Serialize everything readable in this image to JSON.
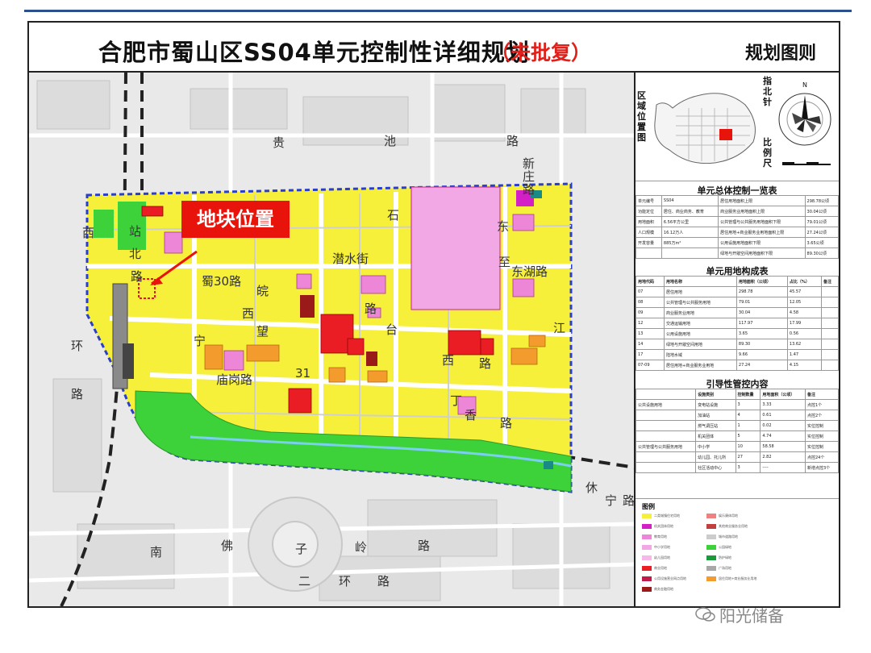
{
  "header": {
    "title": "合肥市蜀山区SS04单元控制性详细规划",
    "status": "（未批复）",
    "sheet": "规划图则"
  },
  "map": {
    "callout": "地块位置",
    "roads": {
      "r1": "贵",
      "r2": "池",
      "r3": "路",
      "r4": "新",
      "r5": "庄",
      "r6": "路",
      "r7": "石",
      "r8": "潜水街",
      "r9": "东",
      "r10": "至",
      "r11": "东湖路",
      "r12": "蜀30路",
      "r13": "皖",
      "r14": "西",
      "r15": "路",
      "r16": "望",
      "r17": "台",
      "r18": "江",
      "r19": "宁",
      "r20": "庙岗路",
      "r21": "31",
      "r22": "西",
      "r23": "路",
      "r24": "丁",
      "r25": "香",
      "r26": "路",
      "r27": "环",
      "r28": "西",
      "r29": "路",
      "r30": "北",
      "r31": "站",
      "r32": "路",
      "r33": "南",
      "r34": "佛",
      "r35": "子",
      "r36": "岭",
      "r37": "路",
      "r38": "休",
      "r39": "宁",
      "r40": "路",
      "r41": "二",
      "r42": "环",
      "r43": "路"
    }
  },
  "side": {
    "locator": {
      "label": "区域位置图",
      "north_label": "指北针",
      "scale_label": "比例尺"
    },
    "overview": {
      "title": "单元总体控制一览表",
      "rows": [
        [
          "单元编号",
          "SS04",
          "居住用地面积上限",
          "298.78公顷"
        ],
        [
          "功能定位",
          "居住、商业商务、教育",
          "商业服务业用地面积上限",
          "30.04公顷"
        ],
        [
          "用地面积",
          "6.56平方公里",
          "公共管理与公共服务用地面积下限",
          "79.01公顷"
        ],
        [
          "人口规模",
          "16.12万人",
          "居住用地+商业服务业用地面积上限",
          "27.24公顷"
        ],
        [
          "开发容量",
          "885万m²",
          "公用设施用地面积下限",
          "3.65公顷"
        ],
        [
          "",
          "",
          "绿地与开敞空间用地面积下限",
          "89.30公顷"
        ]
      ]
    },
    "landuse": {
      "title": "单元用地构成表",
      "header": [
        "用地代码",
        "用地名称",
        "用地面积（公顷）",
        "占比（%）",
        "备注"
      ],
      "rows": [
        [
          "07",
          "居住用地",
          "298.78",
          "45.57",
          ""
        ],
        [
          "08",
          "公共管理与公共服务用地",
          "79.01",
          "12.05",
          ""
        ],
        [
          "09",
          "商业服务业用地",
          "30.04",
          "4.58",
          ""
        ],
        [
          "12",
          "交通运输用地",
          "117.97",
          "17.99",
          ""
        ],
        [
          "13",
          "公用设施用地",
          "3.65",
          "0.56",
          ""
        ],
        [
          "14",
          "绿地与开敞空间用地",
          "89.30",
          "13.62",
          ""
        ],
        [
          "17",
          "陆地水域",
          "9.66",
          "1.47",
          ""
        ],
        [
          "07-09",
          "居住用地+商业服务业用地",
          "27.24",
          "4.15",
          ""
        ]
      ]
    },
    "guidance": {
      "title": "引导性管控内容",
      "header": [
        "",
        "设施类别",
        "控制数量",
        "用地面积（公顷）",
        "备注"
      ],
      "rows": [
        [
          "公共设施用地",
          "变电站设施",
          "3",
          "3.33",
          "点控1个"
        ],
        [
          "",
          "加油站",
          "4",
          "0.61",
          "点控2个"
        ],
        [
          "",
          "燃气调压站",
          "1",
          "0.02",
          "实位控制"
        ],
        [
          "",
          "机关团体",
          "5",
          "4.74",
          "实位控制"
        ],
        [
          "公共管理与公共服务用地",
          "中小学",
          "10",
          "58.58",
          "实位控制"
        ],
        [
          "",
          "幼儿园、托儿所",
          "27",
          "2.82",
          "点控24个"
        ],
        [
          "",
          "社区活动中心",
          "3",
          "----",
          "新增点控3个"
        ]
      ]
    },
    "legend": {
      "title": "图例",
      "items": [
        "二类城镇住宅用地",
        "机关团体用地",
        "教育用地",
        "中小学用地",
        "幼儿园用地",
        "商业用地",
        "公用设施营业网点用地",
        "商务金融用地",
        "娱乐康体用地",
        "其他商业服务业用地",
        "城市道路用地",
        "公园绿地",
        "防护绿地",
        "广场用地",
        "居住用地+商业服务业用地"
      ]
    }
  },
  "watermark": "阳光储备",
  "colors": {
    "residential": "#f6f03a",
    "commercial": "#ea1c24",
    "education": "#ee86d8",
    "park": "#3ed23a",
    "mixed": "#f39b2d",
    "boundary": "#2a3ec8",
    "callout": "#e8140c"
  }
}
